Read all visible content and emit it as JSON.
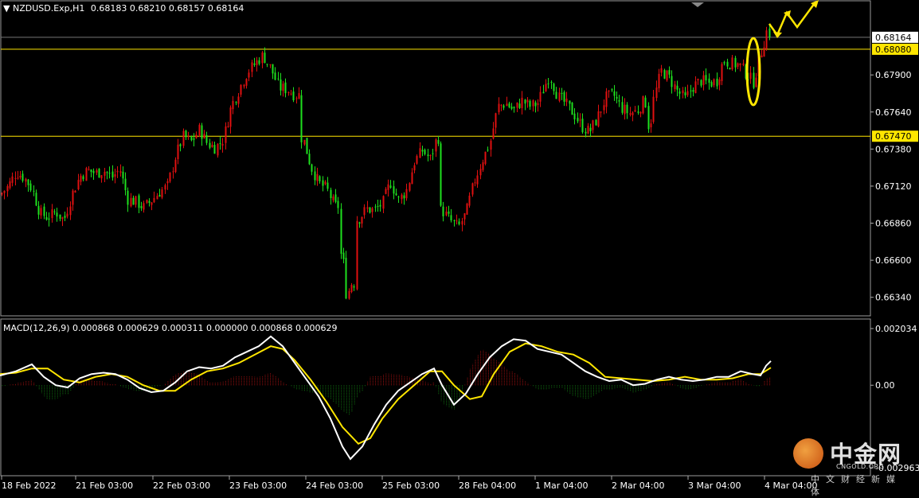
{
  "header": {
    "symbol": "NZDUSD.Exp,H1",
    "ohlc": "0.68183 0.68210 0.68157 0.68164"
  },
  "macd_header": "MACD(12,26,9) 0.000868 0.000629 0.000311 0.000000 0.000868 0.000629",
  "colors": {
    "background": "#000000",
    "bull": "#e01010",
    "bear": "#1ee01e",
    "level_line": "#ffe600",
    "price_tag": "#ffe600",
    "current_tag": "#ffffff",
    "macd_line": "#ffffff",
    "signal_line": "#ffe600"
  },
  "watermark": {
    "main": "中金网",
    "sub": "CNGOLD.ORG",
    "cn": "中文财经新媒体"
  },
  "chart_data": [
    {
      "type": "candlestick",
      "title": "NZDUSD.Exp,H1",
      "ylim": [
        0.6621,
        0.6842
      ],
      "y_ticks": [
        0.6634,
        0.666,
        0.6686,
        0.6712,
        0.6738,
        0.6764,
        0.679
      ],
      "y_tick_labels": [
        "0.66340",
        "0.66600",
        "0.66860",
        "0.67120",
        "0.67380",
        "0.67640",
        "0.67900"
      ],
      "x_tick_labels": [
        "18 Feb 2022",
        "21 Feb 03:00",
        "22 Feb 03:00",
        "23 Feb 03:00",
        "24 Feb 03:00",
        "25 Feb 03:00",
        "28 Feb 04:00",
        "1 Mar 04:00",
        "2 Mar 04:00",
        "3 Mar 04:00",
        "4 Mar 04:00"
      ],
      "horizontal_levels": [
        {
          "value": 0.6808,
          "label": "0.68080"
        },
        {
          "value": 0.6747,
          "label": "0.67470"
        }
      ],
      "current_price": {
        "value": 0.68164,
        "label": "0.68164"
      },
      "close_path": [
        [
          0,
          0.6706
        ],
        [
          10,
          0.6712
        ],
        [
          20,
          0.6722
        ],
        [
          30,
          0.6718
        ],
        [
          40,
          0.671
        ],
        [
          50,
          0.6693
        ],
        [
          60,
          0.669
        ],
        [
          70,
          0.6694
        ],
        [
          80,
          0.6688
        ],
        [
          90,
          0.6706
        ],
        [
          100,
          0.6719
        ],
        [
          110,
          0.6723
        ],
        [
          120,
          0.6721
        ],
        [
          130,
          0.6723
        ],
        [
          140,
          0.6718
        ],
        [
          150,
          0.6724
        ],
        [
          160,
          0.6703
        ],
        [
          170,
          0.6701
        ],
        [
          180,
          0.6697
        ],
        [
          190,
          0.6702
        ],
        [
          200,
          0.6708
        ],
        [
          210,
          0.6712
        ],
        [
          220,
          0.6733
        ],
        [
          230,
          0.6747
        ],
        [
          240,
          0.6743
        ],
        [
          250,
          0.6752
        ],
        [
          260,
          0.6742
        ],
        [
          270,
          0.6739
        ],
        [
          280,
          0.6745
        ],
        [
          290,
          0.6768
        ],
        [
          300,
          0.678
        ],
        [
          310,
          0.6792
        ],
        [
          320,
          0.6798
        ],
        [
          330,
          0.6804
        ],
        [
          340,
          0.6794
        ],
        [
          350,
          0.6781
        ],
        [
          360,
          0.678
        ],
        [
          370,
          0.6776
        ],
        [
          380,
          0.6746
        ],
        [
          390,
          0.6726
        ],
        [
          400,
          0.6714
        ],
        [
          410,
          0.671
        ],
        [
          420,
          0.6698
        ],
        [
          430,
          0.6664
        ],
        [
          435,
          0.6633
        ],
        [
          440,
          0.6644
        ],
        [
          450,
          0.6689
        ],
        [
          460,
          0.6696
        ],
        [
          470,
          0.6695
        ],
        [
          480,
          0.67
        ],
        [
          490,
          0.6715
        ],
        [
          500,
          0.6702
        ],
        [
          510,
          0.6709
        ],
        [
          520,
          0.6729
        ],
        [
          530,
          0.6737
        ],
        [
          540,
          0.6731
        ],
        [
          548,
          0.6746
        ],
        [
          555,
          0.6695
        ],
        [
          565,
          0.6688
        ],
        [
          575,
          0.6683
        ],
        [
          585,
          0.6693
        ],
        [
          595,
          0.6715
        ],
        [
          605,
          0.673
        ],
        [
          615,
          0.6742
        ],
        [
          625,
          0.6768
        ],
        [
          635,
          0.677
        ],
        [
          645,
          0.6765
        ],
        [
          655,
          0.6772
        ],
        [
          665,
          0.6768
        ],
        [
          675,
          0.677
        ],
        [
          685,
          0.6784
        ],
        [
          690,
          0.679
        ],
        [
          700,
          0.6775
        ],
        [
          710,
          0.677
        ],
        [
          720,
          0.6763
        ],
        [
          730,
          0.6754
        ],
        [
          740,
          0.675
        ],
        [
          750,
          0.676
        ],
        [
          760,
          0.6774
        ],
        [
          770,
          0.6776
        ],
        [
          780,
          0.6767
        ],
        [
          790,
          0.6763
        ],
        [
          800,
          0.6765
        ],
        [
          810,
          0.6773
        ],
        [
          815,
          0.6749
        ],
        [
          820,
          0.6772
        ],
        [
          830,
          0.6793
        ],
        [
          840,
          0.6788
        ],
        [
          850,
          0.6779
        ],
        [
          860,
          0.6773
        ],
        [
          870,
          0.6782
        ],
        [
          880,
          0.6786
        ],
        [
          890,
          0.6784
        ],
        [
          900,
          0.6786
        ],
        [
          908,
          0.68
        ],
        [
          918,
          0.6798
        ],
        [
          928,
          0.6797
        ],
        [
          938,
          0.679
        ],
        [
          946,
          0.6785
        ],
        [
          955,
          0.6805
        ],
        [
          963,
          0.6822
        ],
        [
          968,
          0.6817
        ]
      ],
      "annotations": {
        "ellipse": "yellow ellipse around the breakout candles near 4 Mar",
        "arrows": "three yellow zig-zag arrows pointing up-right"
      }
    },
    {
      "type": "macd",
      "title": "MACD(12,26,9)",
      "values": {
        "macd": 0.000868,
        "signal": 0.000629,
        "histogram": 0.000311
      },
      "ylim": [
        -0.002963,
        0.002034
      ],
      "y_tick_labels": [
        "0.002034",
        "0.00",
        "-0.002963"
      ],
      "macd_path": [
        [
          0,
          0.00035
        ],
        [
          20,
          0.0005
        ],
        [
          40,
          0.00075
        ],
        [
          55,
          0.0003
        ],
        [
          70,
          0.0
        ],
        [
          85,
          -8e-05
        ],
        [
          100,
          0.00025
        ],
        [
          115,
          0.0004
        ],
        [
          130,
          0.00045
        ],
        [
          145,
          0.0004
        ],
        [
          160,
          0.0002
        ],
        [
          175,
          -0.0001
        ],
        [
          190,
          -0.00025
        ],
        [
          205,
          -0.0002
        ],
        [
          220,
          0.0001
        ],
        [
          235,
          0.0005
        ],
        [
          250,
          0.00065
        ],
        [
          265,
          0.0006
        ],
        [
          280,
          0.0007
        ],
        [
          295,
          0.001
        ],
        [
          310,
          0.0012
        ],
        [
          325,
          0.0014
        ],
        [
          340,
          0.00175
        ],
        [
          355,
          0.0014
        ],
        [
          370,
          0.0008
        ],
        [
          385,
          0.0002
        ],
        [
          400,
          -0.0004
        ],
        [
          415,
          -0.0012
        ],
        [
          430,
          -0.0022
        ],
        [
          440,
          -0.00265
        ],
        [
          455,
          -0.0022
        ],
        [
          470,
          -0.0014
        ],
        [
          485,
          -0.0007
        ],
        [
          500,
          -0.0002
        ],
        [
          515,
          0.0001
        ],
        [
          530,
          0.0004
        ],
        [
          545,
          0.0006
        ],
        [
          555,
          0.0
        ],
        [
          570,
          -0.0007
        ],
        [
          585,
          -0.0003
        ],
        [
          600,
          0.0004
        ],
        [
          615,
          0.001
        ],
        [
          630,
          0.0014
        ],
        [
          645,
          0.00165
        ],
        [
          660,
          0.0016
        ],
        [
          675,
          0.0013
        ],
        [
          690,
          0.0012
        ],
        [
          705,
          0.0011
        ],
        [
          720,
          0.0008
        ],
        [
          735,
          0.0005
        ],
        [
          750,
          0.0003
        ],
        [
          765,
          0.00015
        ],
        [
          780,
          0.0002
        ],
        [
          795,
          0.0
        ],
        [
          810,
          5e-05
        ],
        [
          825,
          0.0002
        ],
        [
          840,
          0.0003
        ],
        [
          855,
          0.0002
        ],
        [
          870,
          0.00015
        ],
        [
          885,
          0.0002
        ],
        [
          900,
          0.0003
        ],
        [
          915,
          0.0003
        ],
        [
          930,
          0.0005
        ],
        [
          945,
          0.0004
        ],
        [
          955,
          0.00035
        ],
        [
          962,
          0.0007
        ],
        [
          968,
          0.000868
        ]
      ],
      "signal_path": [
        [
          0,
          0.0004
        ],
        [
          20,
          0.00045
        ],
        [
          40,
          0.0006
        ],
        [
          60,
          0.0006
        ],
        [
          80,
          0.0002
        ],
        [
          100,
          0.0001
        ],
        [
          120,
          0.0003
        ],
        [
          140,
          0.0004
        ],
        [
          160,
          0.0003
        ],
        [
          180,
          0.0
        ],
        [
          200,
          -0.0002
        ],
        [
          220,
          -0.0002
        ],
        [
          240,
          0.0002
        ],
        [
          260,
          0.0005
        ],
        [
          280,
          0.0006
        ],
        [
          300,
          0.0008
        ],
        [
          320,
          0.0011
        ],
        [
          340,
          0.0014
        ],
        [
          355,
          0.0013
        ],
        [
          370,
          0.0009
        ],
        [
          390,
          0.0002
        ],
        [
          410,
          -0.0006
        ],
        [
          430,
          -0.0015
        ],
        [
          450,
          -0.0021
        ],
        [
          465,
          -0.0019
        ],
        [
          480,
          -0.0012
        ],
        [
          500,
          -0.0005
        ],
        [
          520,
          0.0
        ],
        [
          540,
          0.0005
        ],
        [
          555,
          0.0005
        ],
        [
          570,
          0.0
        ],
        [
          590,
          -0.0005
        ],
        [
          605,
          -0.0004
        ],
        [
          620,
          0.0004
        ],
        [
          640,
          0.0012
        ],
        [
          660,
          0.0015
        ],
        [
          680,
          0.0014
        ],
        [
          700,
          0.0012
        ],
        [
          720,
          0.0011
        ],
        [
          740,
          0.0008
        ],
        [
          760,
          0.0003
        ],
        [
          780,
          0.00025
        ],
        [
          800,
          0.0002
        ],
        [
          820,
          0.00015
        ],
        [
          840,
          0.0002
        ],
        [
          860,
          0.0003
        ],
        [
          880,
          0.0002
        ],
        [
          900,
          0.0002
        ],
        [
          920,
          0.00025
        ],
        [
          940,
          0.0004
        ],
        [
          955,
          0.0004
        ],
        [
          968,
          0.000629
        ]
      ]
    }
  ]
}
